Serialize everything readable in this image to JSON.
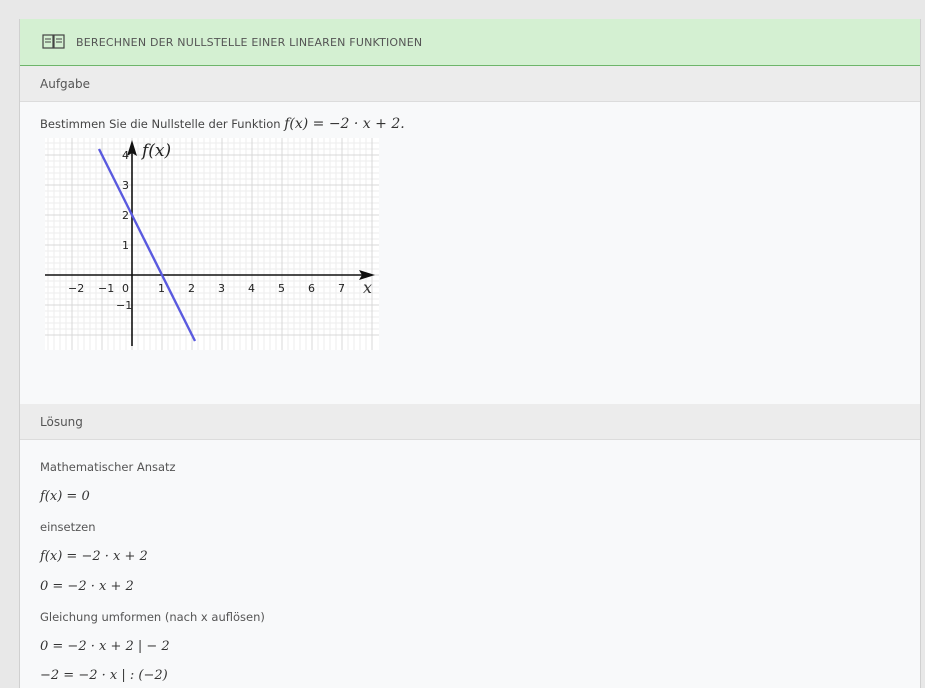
{
  "header": {
    "title": "BERECHNEN DER NULLSTELLE EINER LINEAREN FUNKTIONEN",
    "icon": "book-icon"
  },
  "task": {
    "section_label": "Aufgabe",
    "text": "Bestimmen Sie die Nullstelle der Funktion",
    "formula": "f(x) = −2 · x + 2."
  },
  "graph": {
    "y_axis_label": "f(x)",
    "x_axis_label": "x",
    "x_ticks": [
      "−2",
      "−1",
      "0",
      "1",
      "2",
      "3",
      "4",
      "5",
      "6",
      "7"
    ],
    "y_ticks": [
      "4",
      "3",
      "2",
      "1",
      "−1"
    ],
    "line_color": "#5a5adf"
  },
  "chart_data": {
    "type": "line",
    "series": [
      {
        "x": [
          -1.1,
          2.1
        ],
        "y": [
          4.2,
          -2.2
        ]
      }
    ],
    "xlim": [
      -2.9,
      8.1
    ],
    "ylim": [
      -2,
      4.6
    ],
    "grid": true,
    "xlabel": "x",
    "ylabel": "f(x)"
  },
  "solution": {
    "section_label": "Lösung",
    "lines": [
      "Mathematischer Ansatz",
      "f(x) = 0",
      "einsetzen",
      "f(x) = −2 · x + 2",
      "0 = −2 · x + 2",
      "Gleichung umformen (nach x auflösen)",
      "0 = −2 · x + 2  | − 2",
      "−2 = −2 · x  | : (−2)"
    ]
  }
}
